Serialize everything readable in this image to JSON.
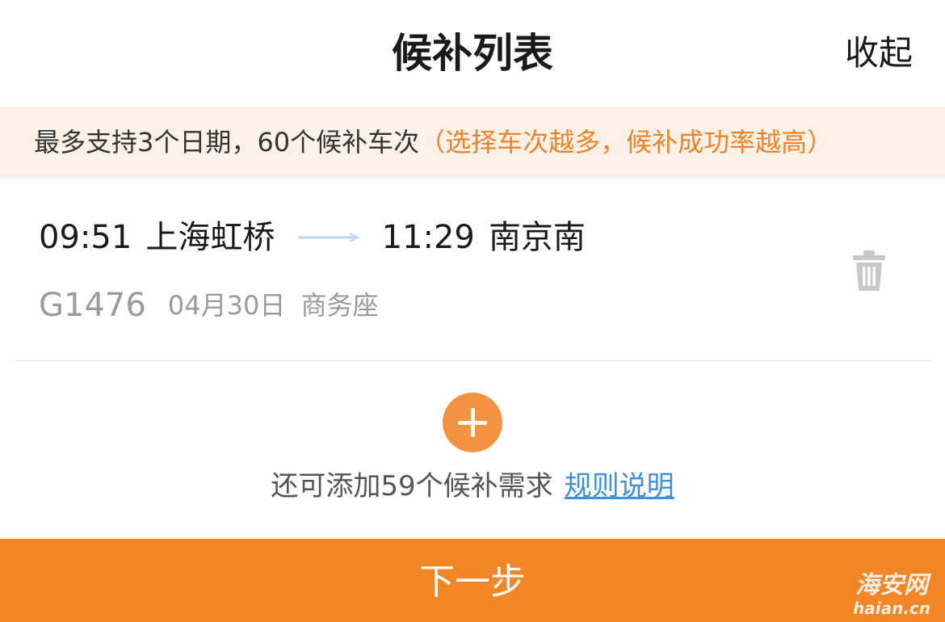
{
  "header": {
    "title": "候补列表",
    "collapse_label": "收起"
  },
  "notice": {
    "main_text": "最多支持3个日期，60个候补车次",
    "highlight_text": "（选择车次越多，候补成功率越高）"
  },
  "train": {
    "depart_time": "09:51",
    "depart_station": "上海虹桥",
    "arrive_time": "11:29",
    "arrive_station": "南京南",
    "train_no": "G1476",
    "date": "04月30日",
    "seat_class": "商务座"
  },
  "add_section": {
    "hint_text": "还可添加59个候补需求",
    "rules_link": "规则说明"
  },
  "footer": {
    "next_label": "下一步"
  },
  "watermark": {
    "cn": "海安网",
    "en": "haian.cn"
  },
  "colors": {
    "accent": "#f28526",
    "add_button": "#f39342",
    "notice_bg": "#fdf0e6",
    "highlight_text": "#f0822a",
    "link": "#3f8fe0",
    "muted_text": "#9a9a9a"
  },
  "icons": {
    "route_arrow": "arrow-right-icon",
    "delete": "trash-icon",
    "add": "plus-icon"
  }
}
